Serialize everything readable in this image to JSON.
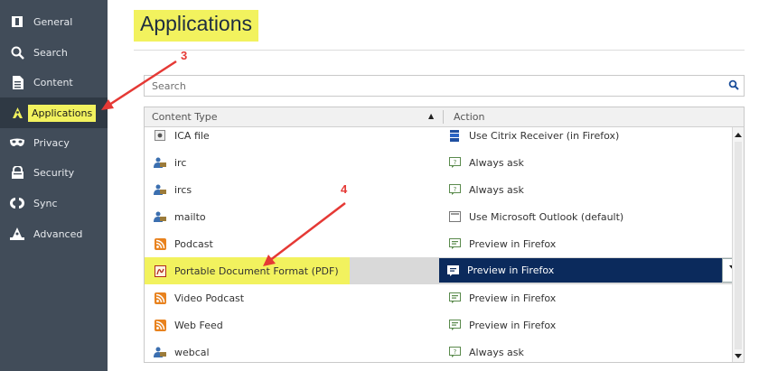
{
  "sidebar": {
    "items": [
      {
        "label": "General",
        "icon": "general-icon"
      },
      {
        "label": "Search",
        "icon": "search-icon"
      },
      {
        "label": "Content",
        "icon": "content-icon"
      },
      {
        "label": "Applications",
        "icon": "applications-icon",
        "active": true
      },
      {
        "label": "Privacy",
        "icon": "privacy-mask-icon"
      },
      {
        "label": "Security",
        "icon": "lock-icon"
      },
      {
        "label": "Sync",
        "icon": "sync-icon"
      },
      {
        "label": "Advanced",
        "icon": "wizard-hat-icon"
      }
    ]
  },
  "page": {
    "title": "Applications"
  },
  "search": {
    "placeholder": "Search"
  },
  "table": {
    "col_content_type": "Content Type",
    "col_action": "Action",
    "rows": [
      {
        "type": "ICA file",
        "type_icon": "ica-file-icon",
        "action": "Use Citrix Receiver (in Firefox)",
        "action_icon": "citrix-icon"
      },
      {
        "type": "irc",
        "type_icon": "irc-icon",
        "action": "Always ask",
        "action_icon": "ask-icon"
      },
      {
        "type": "ircs",
        "type_icon": "irc-icon",
        "action": "Always ask",
        "action_icon": "ask-icon"
      },
      {
        "type": "mailto",
        "type_icon": "mailto-icon",
        "action": "Use Microsoft Outlook (default)",
        "action_icon": "outlook-icon"
      },
      {
        "type": "Podcast",
        "type_icon": "rss-icon",
        "action": "Preview in Firefox",
        "action_icon": "preview-icon"
      },
      {
        "type": "Portable Document Format (PDF)",
        "type_icon": "pdf-icon",
        "action": "Preview in Firefox",
        "action_icon": "preview-icon",
        "selected": true
      },
      {
        "type": "Video Podcast",
        "type_icon": "rss-icon",
        "action": "Preview in Firefox",
        "action_icon": "preview-icon"
      },
      {
        "type": "Web Feed",
        "type_icon": "rss-icon",
        "action": "Preview in Firefox",
        "action_icon": "preview-icon"
      },
      {
        "type": "webcal",
        "type_icon": "irc-icon",
        "action": "Always ask",
        "action_icon": "ask-icon"
      }
    ]
  },
  "annotations": {
    "step3": "3",
    "step4": "4"
  },
  "colors": {
    "highlight": "#f2f25e",
    "sidebar": "#414c59",
    "selection": "#0b2a5c",
    "annotation": "#e53935"
  }
}
